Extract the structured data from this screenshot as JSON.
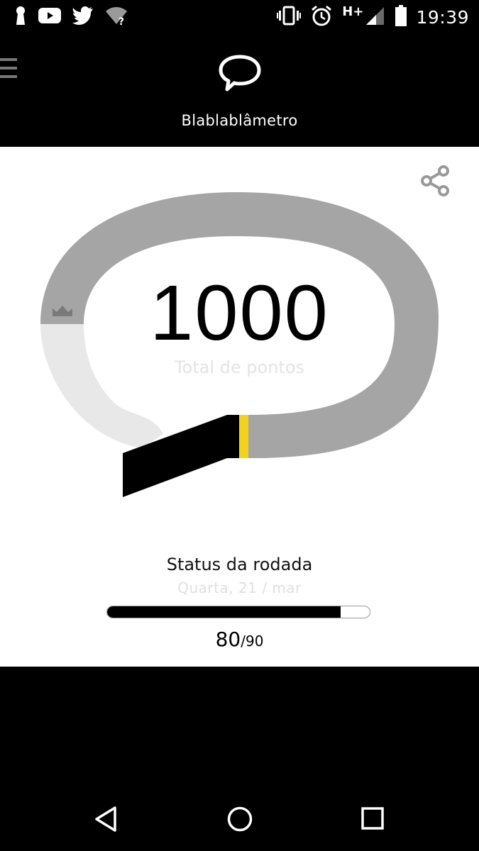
{
  "status_bar": {
    "time": "19:39",
    "network": "H+",
    "icons": [
      "keyhole-icon",
      "youtube-icon",
      "twitter-icon",
      "wifi-unknown-icon",
      "vibrate-icon",
      "alarm-icon",
      "signal-icon",
      "battery-icon"
    ],
    "wifi_badge": "?"
  },
  "header": {
    "title": "Blablablâmetro",
    "logo_icon": "speech-bubble-icon",
    "menu_icon": "menu-icon"
  },
  "meter": {
    "total_points": "1000",
    "total_label": "Total de pontos",
    "share_icon": "share-icon",
    "marker_icon": "crown-icon",
    "colors": {
      "track": "#a5a5a5",
      "track_light": "#e8e8e8",
      "pointer": "#000000",
      "marker": "#f2d21b"
    }
  },
  "round_status": {
    "title": "Status da rodada",
    "date": "Quarta, 21 / mar",
    "current": "80",
    "separator": "/",
    "total": "90",
    "progress_fraction": 0.889
  },
  "nav": {
    "icons": [
      "back-icon",
      "home-icon",
      "recents-icon"
    ]
  }
}
